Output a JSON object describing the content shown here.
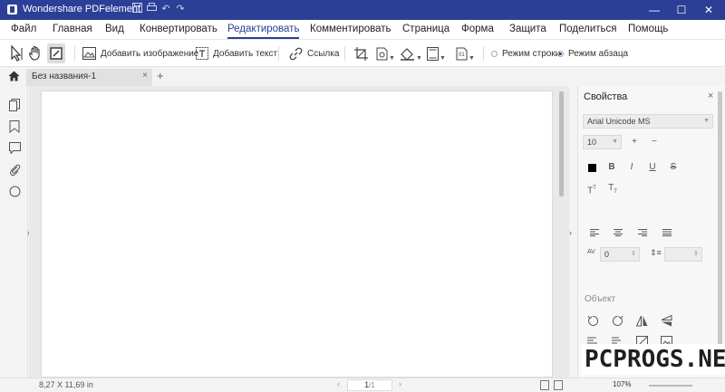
{
  "titlebar": {
    "app_name": "Wondershare PDFelement",
    "min": "—",
    "max": "☐",
    "close": "✕"
  },
  "menu": {
    "items": [
      "Файл",
      "Главная",
      "Вид",
      "Конвертировать",
      "Редактировать",
      "Комментировать",
      "Страница",
      "Форма",
      "Защита",
      "Поделиться",
      "Помощь"
    ],
    "active": "Редактировать"
  },
  "toolbar": {
    "add_image": "Добавить изображение",
    "add_text": "Добавить текст",
    "link": "Ссылка",
    "line_mode": "Режим строки",
    "paragraph_mode": "Режим абзаца",
    "selected_mode": "paragraph"
  },
  "tab": {
    "name": "Без названия-1",
    "close": "×",
    "add": "+"
  },
  "properties": {
    "title": "Свойства",
    "close": "×",
    "font": "Arial Unicode MS",
    "size": "10",
    "plus": "+",
    "minus": "−",
    "bold": "B",
    "italic": "I",
    "underline": "U",
    "strike": "S",
    "superscript": "T",
    "subscript": "T",
    "char_spacing": "0",
    "object_section": "Объект"
  },
  "status": {
    "dimensions": "8,27 X 11,69 in",
    "page_current": "1",
    "page_total": "/1",
    "zoom": "107%"
  },
  "watermark": "PCPROGS.NET",
  "colors": {
    "accent": "#2b3f97",
    "titlebar": "#2b3f97"
  }
}
